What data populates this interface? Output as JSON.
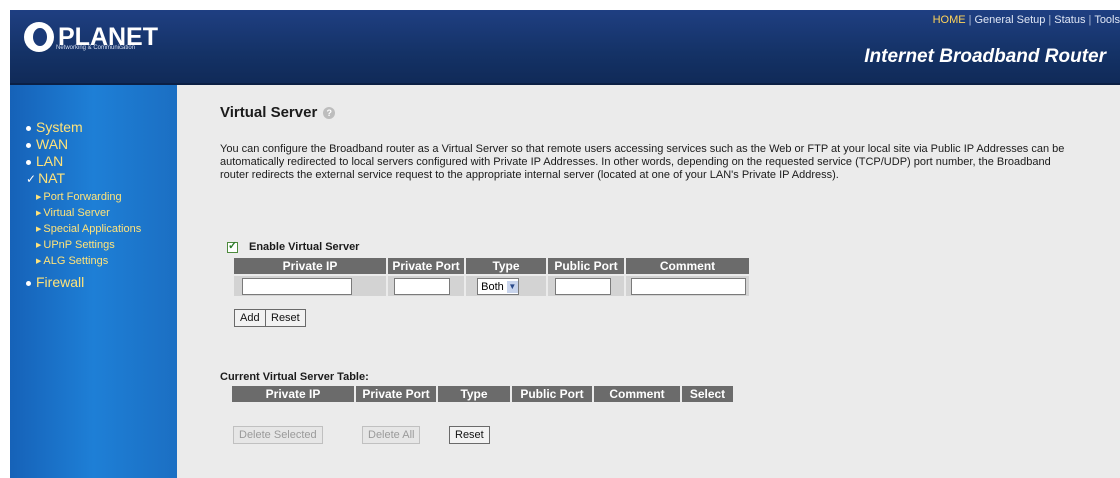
{
  "header": {
    "logo_text": "PLANET",
    "logo_sub": "Networking & Communication",
    "links": [
      "HOME",
      "General Setup",
      "Status",
      "Tools"
    ],
    "product": "Internet Broadband Router"
  },
  "sidebar": {
    "items": [
      {
        "label": "System"
      },
      {
        "label": "WAN"
      },
      {
        "label": "LAN"
      },
      {
        "label": "NAT"
      },
      {
        "label": "Firewall"
      }
    ],
    "nat_sub": [
      {
        "label": "Port Forwarding"
      },
      {
        "label": "Virtual Server"
      },
      {
        "label": "Special Applications"
      },
      {
        "label": "UPnP Settings"
      },
      {
        "label": "ALG Settings"
      }
    ]
  },
  "main": {
    "title": "Virtual Server",
    "description": "You can configure the Broadband router as a Virtual Server so that remote users accessing services such as the Web or FTP at your local site via Public IP Addresses can be automatically redirected to local servers configured with Private IP Addresses. In other words, depending on the requested service (TCP/UDP) port number, the Broadband router redirects the external service request to the appropriate internal server (located at one of your LAN's Private IP Address).",
    "enable_label": "Enable Virtual Server",
    "enabled": true,
    "form_headers": [
      "Private IP",
      "Private Port",
      "Type",
      "Public Port",
      "Comment"
    ],
    "form_values": {
      "private_ip": "",
      "private_port": "",
      "type": "Both",
      "public_port": "",
      "comment": ""
    },
    "add_label": "Add",
    "reset_label": "Reset",
    "table_label": "Current Virtual Server Table:",
    "table_headers": [
      "Private IP",
      "Private Port",
      "Type",
      "Public Port",
      "Comment",
      "Select"
    ],
    "delete_selected_label": "Delete Selected",
    "delete_all_label": "Delete All",
    "reset2_label": "Reset"
  }
}
